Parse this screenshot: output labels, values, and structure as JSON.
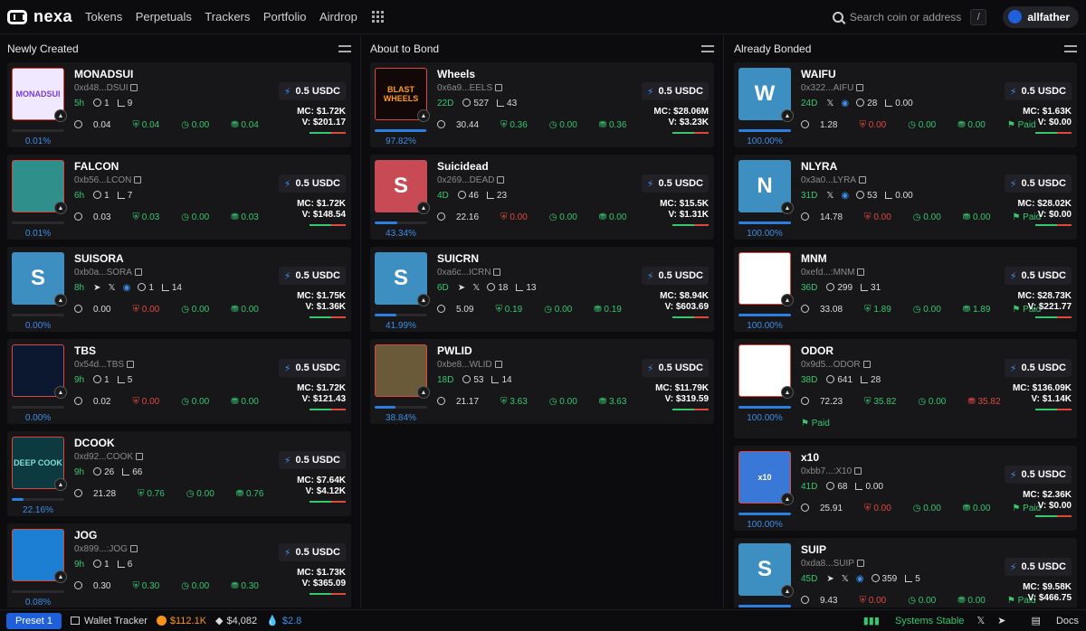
{
  "app": {
    "name": "nexa"
  },
  "nav": [
    "Tokens",
    "Perpetuals",
    "Trackers",
    "Portfolio",
    "Airdrop"
  ],
  "search": {
    "placeholder": "Search coin or address",
    "shortcut": "/"
  },
  "user": {
    "name": "allfather"
  },
  "buy_label": "0.5 USDC",
  "columns": [
    {
      "title": "Newly Created",
      "cards": [
        {
          "name": "MONADSUI",
          "addr": "0xd48...DSUI",
          "age": "5h",
          "holders": "1",
          "txns": "9",
          "bal": "0.04",
          "s1": "0.04",
          "s1c": "g",
          "s2": "0.00",
          "s3": "0.04",
          "s3c": "g",
          "mc": "MC: $1.72K",
          "v": "V: $201.17",
          "pct": "0.01%",
          "prog": 0.0001,
          "bg": "#efe8ff",
          "avtext": "MONADSUI",
          "avcolor": "#7a3bd9"
        },
        {
          "name": "FALCON",
          "addr": "0xb56...LCON",
          "age": "6h",
          "holders": "1",
          "txns": "7",
          "bal": "0.03",
          "s1": "0.03",
          "s1c": "g",
          "s2": "0.00",
          "s3": "0.03",
          "s3c": "g",
          "mc": "MC: $1.72K",
          "v": "V: $148.54",
          "pct": "0.01%",
          "prog": 0.0001,
          "bg": "#2f8f8a",
          "avtext": "",
          "avcolor": "#fff"
        },
        {
          "name": "SUISORA",
          "addr": "0xb0a...SORA",
          "age": "8h",
          "social": true,
          "holders": "1",
          "txns": "14",
          "bal": "0.00",
          "s1": "0.00",
          "s1c": "r",
          "s2": "0.00",
          "s3": "0.00",
          "s3c": "g",
          "mc": "MC: $1.75K",
          "v": "V: $1.36K",
          "pct": "0.00%",
          "prog": 0,
          "bg": "#3d8fc2",
          "letter": "S"
        },
        {
          "name": "TBS",
          "addr": "0x54d...TBS",
          "age": "9h",
          "holders": "1",
          "txns": "5",
          "bal": "0.02",
          "s1": "0.00",
          "s1c": "r",
          "s2": "0.00",
          "s3": "0.00",
          "s3c": "g",
          "mc": "MC: $1.72K",
          "v": "V: $121.43",
          "pct": "0.00%",
          "prog": 0,
          "bg": "#0b1830",
          "avtext": "",
          "avcolor": "#3d8de6"
        },
        {
          "name": "DCOOK",
          "addr": "0xd92...COOK",
          "age": "9h",
          "holders": "26",
          "txns": "66",
          "bal": "21.28",
          "s1": "0.76",
          "s1c": "g",
          "s2": "0.00",
          "s3": "0.76",
          "s3c": "g",
          "mc": "MC: $7.64K",
          "v": "V: $4.12K",
          "pct": "22.16%",
          "prog": 0.2216,
          "bg": "#0d3a40",
          "avtext": "DEEP COOK",
          "avcolor": "#7fe0d8"
        },
        {
          "name": "JOG",
          "addr": "0x899...:JOG",
          "age": "9h",
          "holders": "1",
          "txns": "6",
          "bal": "0.30",
          "s1": "0.30",
          "s1c": "g",
          "s2": "0.00",
          "s3": "0.30",
          "s3c": "g",
          "mc": "MC: $1.73K",
          "v": "V: $365.09",
          "pct": "0.08%",
          "prog": 0.0008,
          "bg": "#1c7fd1",
          "avtext": "",
          "avcolor": "#fff"
        }
      ]
    },
    {
      "title": "About to Bond",
      "cards": [
        {
          "name": "Wheels",
          "addr": "0x6a9...EELS",
          "age": "22D",
          "holders": "527",
          "txns": "43",
          "bal": "30.44",
          "s1": "0.36",
          "s1c": "g",
          "s2": "0.00",
          "s3": "0.36",
          "s3c": "g",
          "mc": "MC: $28.06M",
          "v": "V: $3.23K",
          "pct": "97.82%",
          "prog": 0.9782,
          "bg": "#120808",
          "avtext": "BLAST WHEELS",
          "avcolor": "#ff9a1f"
        },
        {
          "name": "Suicidead",
          "addr": "0x269...DEAD",
          "age": "4D",
          "holders": "46",
          "txns": "23",
          "bal": "22.16",
          "s1": "0.00",
          "s1c": "r",
          "s2": "0.00",
          "s3": "0.00",
          "s3c": "g",
          "mc": "MC: $15.5K",
          "v": "V: $1.31K",
          "pct": "43.34%",
          "prog": 0.4334,
          "bg": "#c84a55",
          "letter": "S"
        },
        {
          "name": "SUICRN",
          "addr": "0xa6c...ICRN",
          "age": "6D",
          "social": true,
          "noweb": true,
          "holders": "18",
          "txns": "13",
          "bal": "5.09",
          "s1": "0.19",
          "s1c": "g",
          "s2": "0.00",
          "s3": "0.19",
          "s3c": "g",
          "mc": "MC: $8.94K",
          "v": "V: $603.69",
          "pct": "41.99%",
          "prog": 0.4199,
          "bg": "#3d8fc2",
          "letter": "S"
        },
        {
          "name": "PWLID",
          "addr": "0xbe8...WLID",
          "age": "18D",
          "holders": "53",
          "txns": "14",
          "bal": "21.17",
          "s1": "3.63",
          "s1c": "g",
          "s2": "0.00",
          "s3": "3.63",
          "s3c": "g",
          "mc": "MC: $11.79K",
          "v": "V: $319.59",
          "pct": "38.84%",
          "prog": 0.3884,
          "bg": "#6a5a3a",
          "avtext": "",
          "avcolor": "#fff"
        }
      ]
    },
    {
      "title": "Already Bonded",
      "cards": [
        {
          "name": "WAIFU",
          "addr": "0x322...AIFU",
          "age": "24D",
          "xweb": true,
          "holders": "28",
          "txns": "0.00",
          "bal": "1.28",
          "s1": "0.00",
          "s1c": "r",
          "s2": "0.00",
          "s3": "0.00",
          "s3c": "g",
          "paid": "Paid",
          "mc": "MC: $1.63K",
          "v": "V: $0.00",
          "pct": "100.00%",
          "prog": 1,
          "bg": "#3d8fc2",
          "letter": "W"
        },
        {
          "name": "NLYRA",
          "addr": "0x3a0...LYRA",
          "age": "31D",
          "xweb": true,
          "holders": "53",
          "txns": "0.00",
          "bal": "14.78",
          "s1": "0.00",
          "s1c": "r",
          "s2": "0.00",
          "s3": "0.00",
          "s3c": "g",
          "paid": "Paid",
          "mc": "MC: $28.02K",
          "v": "V: $0.00",
          "pct": "100.00%",
          "prog": 1,
          "bg": "#3d8fc2",
          "letter": "N"
        },
        {
          "name": "MNM",
          "addr": "0xefd...:MNM",
          "age": "36D",
          "holders": "299",
          "txns": "31",
          "bal": "33.08",
          "s1": "1.89",
          "s1c": "g",
          "s2": "0.00",
          "s3": "1.89",
          "s3c": "g",
          "paid": "Paid",
          "mc": "MC: $28.73K",
          "v": "V: $221.77",
          "pct": "100.00%",
          "prog": 1,
          "bg": "#ffffff",
          "avtext": "",
          "avcolor": "#000"
        },
        {
          "name": "ODOR",
          "addr": "0x9d5...ODOR",
          "age": "38D",
          "holders": "641",
          "txns": "28",
          "bal": "72.23",
          "s1": "35.82",
          "s1c": "g",
          "s2": "0.00",
          "s3": "35.82",
          "s3c": "r",
          "paid": "Paid",
          "mc": "MC: $136.09K",
          "v": "V: $1.14K",
          "pct": "100.00%",
          "prog": 1,
          "bg": "#ffffff",
          "avtext": "",
          "avcolor": "#000",
          "tall": true
        },
        {
          "name": "x10",
          "addr": "0xbb7...:X10",
          "age": "41D",
          "holders": "68",
          "txns": "0.00",
          "bal": "25.91",
          "s1": "0.00",
          "s1c": "r",
          "s2": "0.00",
          "s3": "0.00",
          "s3c": "g",
          "paid": "Paid",
          "mc": "MC: $2.36K",
          "v": "V: $0.00",
          "pct": "100.00%",
          "prog": 1,
          "bg": "#3a78d8",
          "avtext": "x10",
          "avcolor": "#fff"
        },
        {
          "name": "SUIP",
          "addr": "0xda8...SUIP",
          "age": "45D",
          "social": true,
          "holders": "359",
          "txns": "5",
          "bal": "9.43",
          "s1": "0.00",
          "s1c": "r",
          "s2": "0.00",
          "s3": "0.00",
          "s3c": "g",
          "paid": "Paid",
          "mc": "MC: $9.58K",
          "v": "V: $466.75",
          "pct": "100.00%",
          "prog": 1,
          "bg": "#3d8fc2",
          "letter": "S"
        }
      ]
    }
  ],
  "bottom": {
    "preset": "Preset 1",
    "wallet": "Wallet Tracker",
    "btc": "$112.1K",
    "eth": "$4,082",
    "sui": "$2.8",
    "status": "Systems Stable",
    "docs": "Docs"
  },
  "colors": {
    "accent": "#1f5fd9",
    "green": "#37c76e",
    "red": "#e0483e"
  }
}
